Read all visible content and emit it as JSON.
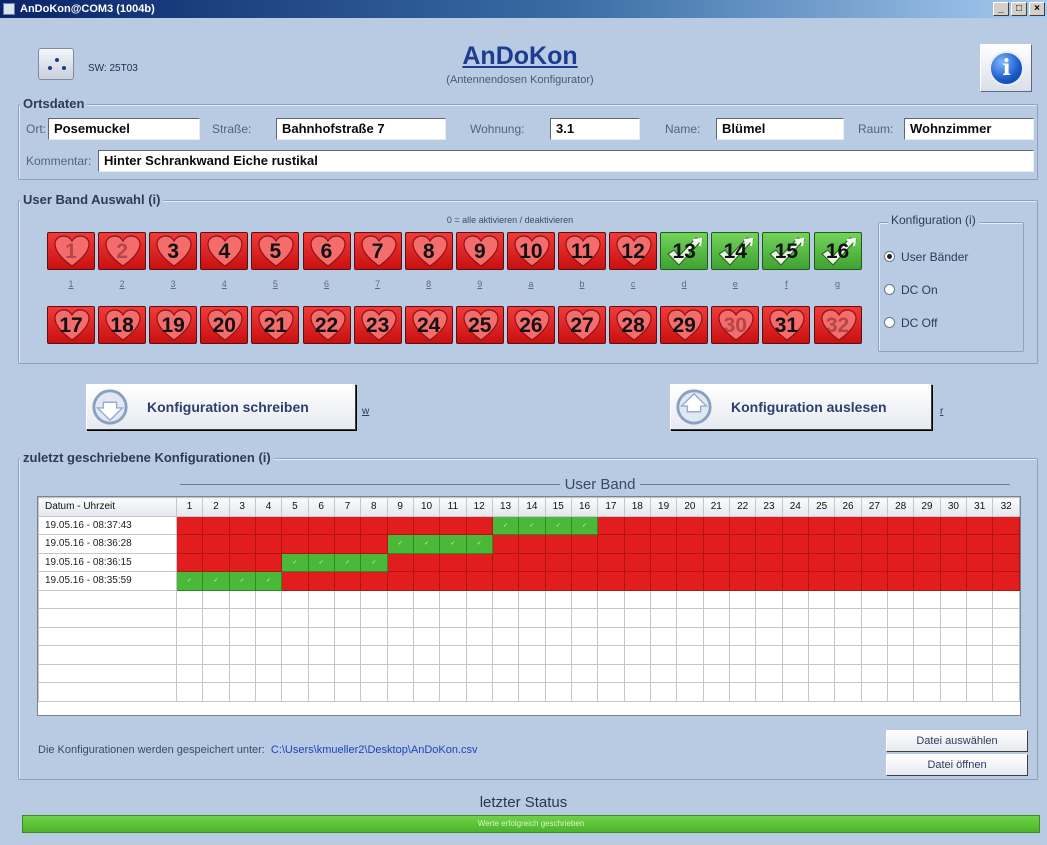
{
  "window": {
    "title": "AnDoKon@COM3 (1004b)",
    "min": "_",
    "max": "□",
    "close": "×"
  },
  "header": {
    "sw": "SW: 25T03",
    "title": "AnDoKon",
    "subtitle": "(Antennendosen Konfigurator)",
    "info_glyph": "i"
  },
  "ortsdaten": {
    "legend": "Ortsdaten",
    "ort_label": "Ort:",
    "ort": "Posemuckel",
    "strasse_label": "Straße:",
    "strasse": "Bahnhofstraße 7",
    "wohnung_label": "Wohnung:",
    "wohnung": "3.1",
    "name_label": "Name:",
    "name": "Blümel",
    "raum_label": "Raum:",
    "raum": "Wohnzimmer",
    "kommentar_label": "Kommentar:",
    "kommentar": "Hinter Schrankwand Eiche rustikal"
  },
  "band_selection": {
    "legend": "User Band Auswahl (i)",
    "hint": "0 = alle aktivieren / deaktivieren",
    "keys": [
      "1",
      "2",
      "3",
      "4",
      "5",
      "6",
      "7",
      "8",
      "9",
      "a",
      "b",
      "c",
      "d",
      "e",
      "f",
      "g"
    ],
    "enabled_bands": [
      13,
      14,
      15,
      16
    ],
    "faded_bands": [
      1,
      2,
      30,
      32
    ],
    "colors": {
      "enabled": "#4cb83a",
      "disabled": "#e21d1d"
    }
  },
  "konfiguration": {
    "legend": "Konfiguration (i)",
    "options": [
      "User Bänder",
      "DC On",
      "DC Off"
    ],
    "selected": "User Bänder"
  },
  "actions": {
    "write_label": "Konfiguration schreiben",
    "write_key": "w",
    "read_label": "Konfiguration auslesen",
    "read_key": "r"
  },
  "history": {
    "legend": "zuletzt geschriebene Konfigurationen (i)",
    "userband_title": "User Band",
    "col_datetime": "Datum - Uhrzeit",
    "rows": [
      {
        "datetime": "19.05.16 - 08:37:43",
        "enabled": [
          13,
          14,
          15,
          16
        ]
      },
      {
        "datetime": "19.05.16 - 08:36:28",
        "enabled": [
          9,
          10,
          11,
          12
        ]
      },
      {
        "datetime": "19.05.16 - 08:36:15",
        "enabled": [
          5,
          6,
          7,
          8
        ]
      },
      {
        "datetime": "19.05.16 - 08:35:59",
        "enabled": [
          1,
          2,
          3,
          4
        ]
      }
    ],
    "empty_rows": 6,
    "save_label": "Die Konfigurationen werden gespeichert unter:",
    "save_path": "C:\\Users\\kmueller2\\Desktop\\AnDoKon.csv",
    "choose_file": "Datei auswählen",
    "open_file": "Datei öffnen"
  },
  "status": {
    "title": "letzter Status",
    "text": "Werte erfolgreich geschrieben",
    "color": "#5bc636"
  }
}
